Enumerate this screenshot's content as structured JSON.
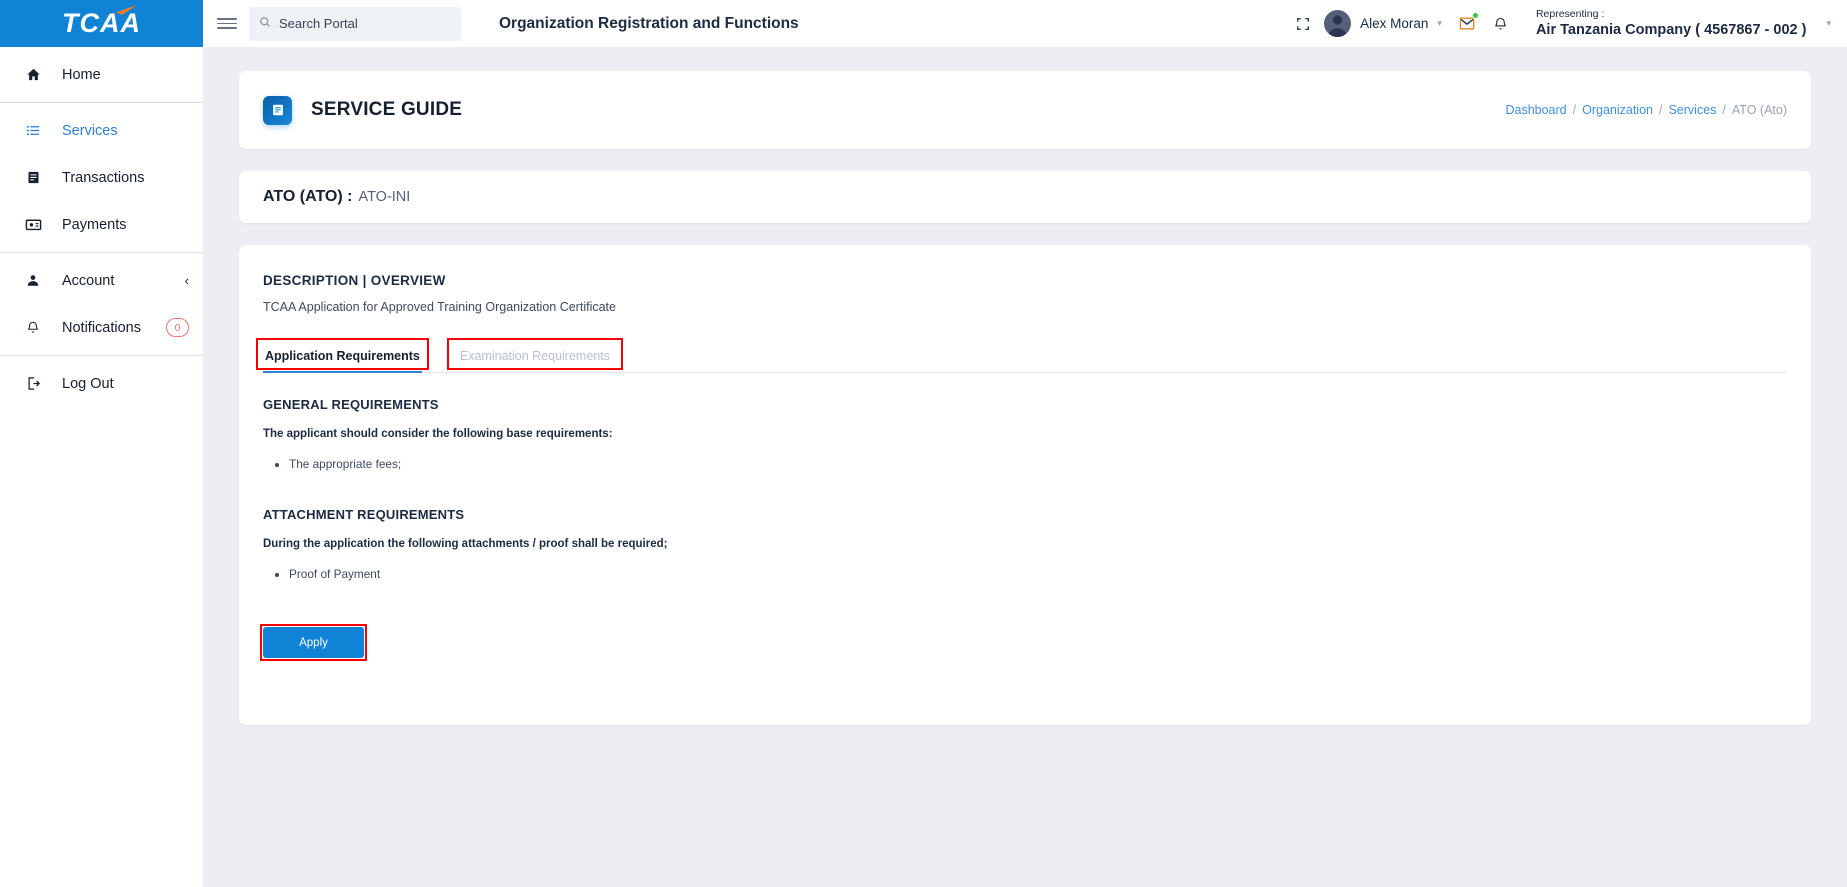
{
  "brand": {
    "name": "TCAA",
    "logo_icon": "tcaa-swoosh-logo",
    "bg_color": "#1083d6"
  },
  "sidebar": {
    "groups": [
      {
        "items": [
          {
            "label": "Home",
            "icon": "home-icon",
            "active": false
          }
        ]
      },
      {
        "items": [
          {
            "label": "Services",
            "icon": "list-icon",
            "active": true
          },
          {
            "label": "Transactions",
            "icon": "book-icon",
            "active": false
          },
          {
            "label": "Payments",
            "icon": "card-icon",
            "active": false
          }
        ]
      },
      {
        "items": [
          {
            "label": "Account",
            "icon": "user-icon",
            "active": false,
            "chevron": "‹"
          },
          {
            "label": "Notifications",
            "icon": "bell-icon",
            "active": false,
            "badge": "0"
          }
        ]
      },
      {
        "items": [
          {
            "label": "Log Out",
            "icon": "logout-icon",
            "active": false
          }
        ]
      }
    ]
  },
  "topbar": {
    "menu_icon": "hamburger-icon",
    "search": {
      "icon": "search-icon",
      "placeholder": "Search Portal",
      "value": ""
    },
    "page_heading": "Organization Registration and Functions",
    "fullscreen_icon": "fullscreen-icon",
    "user": {
      "name": "Alex Moran",
      "avatar_icon": "avatar-icon",
      "caret": "▾"
    },
    "mail_icon": "mail-icon",
    "mail_badge_color": "#2ecc40",
    "bell_icon": "bell-icon",
    "representing": {
      "label": "Representing :",
      "value": "Air Tanzania Company ( 4567867 - 002 )",
      "caret": "▾"
    }
  },
  "service_guide": {
    "icon": "document-icon",
    "title": "SERVICE GUIDE",
    "breadcrumb": [
      {
        "label": "Dashboard",
        "link": true
      },
      {
        "label": "Organization",
        "link": true
      },
      {
        "label": "Services",
        "link": true
      },
      {
        "label": "ATO (Ato)",
        "link": false
      }
    ],
    "breadcrumb_separator": "/"
  },
  "service": {
    "title": "ATO (ATO) :",
    "code": "ATO-INI"
  },
  "description": {
    "section_title": "DESCRIPTION | OVERVIEW",
    "text": "TCAA Application for Approved Training Organization Certificate",
    "tabs": [
      {
        "label": "Application Requirements",
        "active": true
      },
      {
        "label": "Examination Requirements",
        "active": false
      }
    ],
    "general": {
      "heading": "GENERAL REQUIREMENTS",
      "lead": "The applicant should consider the following base requirements:",
      "items": [
        "The appropriate fees;"
      ]
    },
    "attachment": {
      "heading": "ATTACHMENT REQUIREMENTS",
      "lead": "During the application the following attachments / proof shall be required;",
      "items": [
        "Proof of Payment"
      ]
    },
    "apply_label": "Apply"
  },
  "colors": {
    "accent": "#1083d6",
    "link": "#3f8fe0",
    "annotation": "#f50000",
    "page_bg": "#eceef3",
    "badge_red": "#f0766f"
  }
}
